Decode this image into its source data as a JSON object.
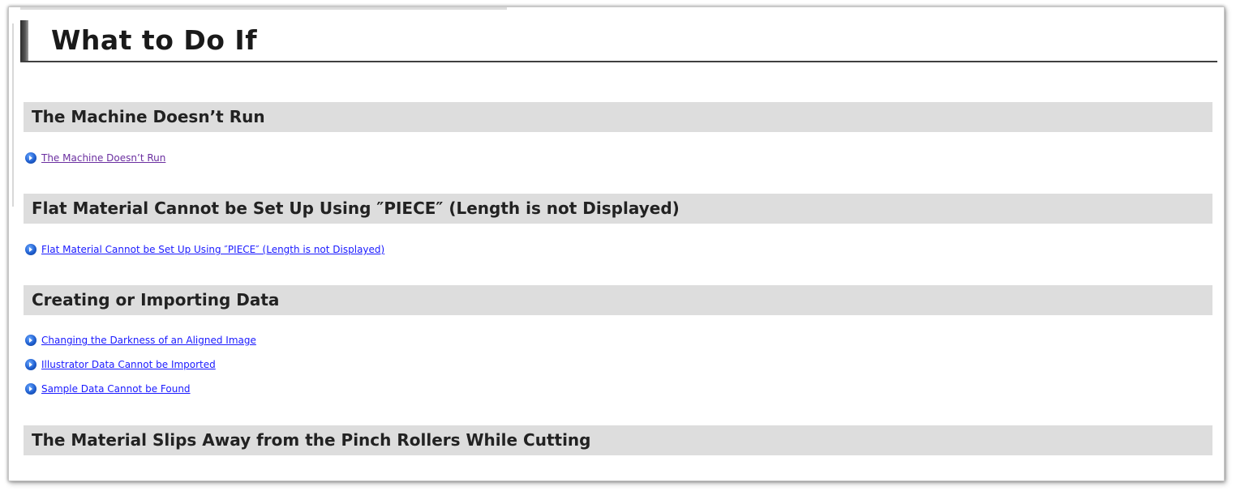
{
  "page": {
    "title": "What to Do If"
  },
  "sections": [
    {
      "heading": "The Machine Doesn’t Run",
      "links": [
        {
          "label": "The Machine Doesn’t Run",
          "visited": true
        }
      ]
    },
    {
      "heading": "Flat Material Cannot be Set Up Using ″PIECE″ (Length is not Displayed)",
      "links": [
        {
          "label": "Flat Material Cannot be Set Up Using ″PIECE″ (Length is not Displayed)",
          "visited": false
        }
      ]
    },
    {
      "heading": "Creating or Importing Data",
      "links": [
        {
          "label": "Changing the Darkness of an Aligned Image",
          "visited": false
        },
        {
          "label": "Illustrator Data Cannot be Imported",
          "visited": false
        },
        {
          "label": "Sample Data Cannot be Found",
          "visited": false
        }
      ]
    },
    {
      "heading": "The Material Slips Away from the Pinch Rollers While Cutting",
      "links": []
    }
  ],
  "colors": {
    "link": "#1a1aff",
    "visited_link": "#6b2fa0",
    "section_bg": "#dddddd",
    "bullet_icon": "#1f5fd0"
  },
  "icons": {
    "link_bullet": "circle-arrow-icon"
  }
}
